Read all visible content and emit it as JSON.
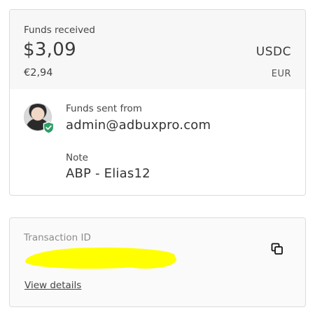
{
  "funds": {
    "received_label": "Funds received",
    "amount": "$3,09",
    "currency": "USDC",
    "fiat_amount": "€2,94",
    "fiat_currency": "EUR"
  },
  "sender": {
    "label": "Funds sent from",
    "email": "admin@adbuxpro.com",
    "avatar_icon": "user-avatar",
    "verified_icon": "verified-shield-icon",
    "verified_color": "#2e9e6a"
  },
  "note": {
    "label": "Note",
    "value": "ABP - Elias12"
  },
  "transaction": {
    "id_label": "Transaction ID",
    "id_value": "",
    "copy_icon": "copy-icon",
    "view_details": "View details",
    "redaction_color": "#ffff00"
  }
}
